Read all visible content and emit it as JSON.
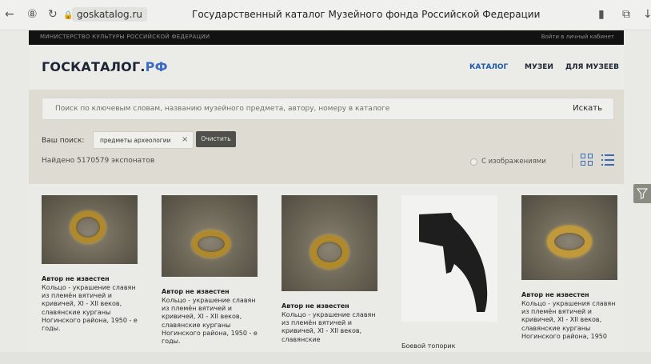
{
  "browser": {
    "url": "goskatalog.ru",
    "title": "Государственный каталог Музейного фонда Российской Федерации"
  },
  "topbar": {
    "ministry": "МИНИСТЕРСТВО КУЛЬТУРЫ РОССИЙСКОЙ ФЕДЕРАЦИИ",
    "login": "Войти в личный кабинет"
  },
  "header": {
    "logo_main": "ГОСКАТАЛОГ.",
    "logo_suffix": "РФ",
    "nav": [
      {
        "label": "КАТАЛОГ",
        "active": true
      },
      {
        "label": "МУЗЕИ",
        "active": false
      },
      {
        "label": "ДЛЯ МУЗЕЕВ",
        "active": false
      }
    ]
  },
  "search": {
    "placeholder": "Поиск по ключевым словам, названию музейного предмета, автору, номеру в каталоге",
    "button": "Искать",
    "your_search_label": "Ваш поиск:",
    "chip": "предметы археологии",
    "chip_close": "×",
    "clear_button": "Очистить",
    "found": "Найдено 5170579 экспонатов",
    "with_images": "С изображениями"
  },
  "results": [
    {
      "author": "Автор не известен",
      "desc": "Кольцо - украшение славян из племён вятичей и кривичей, XI - XII веков, славянские курганы Ногинского района, 1950 - е годы."
    },
    {
      "author": "Автор не известен",
      "desc": "Кольцо - украшение славян из племён вятичей и кривичей, XI - XII веков, славянские курганы Ногинского района, 1950 - е годы."
    },
    {
      "author": "Автор не известен",
      "desc": "Кольцо - украшение славян из племён вятичей и кривичей, XI - XII веков, славянские"
    },
    {
      "author": "",
      "desc": "Боевой топорик"
    },
    {
      "author": "Автор не известен",
      "desc": "Кольцо - украшения славян из племён вятичей и кривичей, XI - XII веков, славянские курганы Ногинского района, 1950"
    }
  ],
  "colors": {
    "accent": "#1d58ad",
    "logo_dark": "#1d2434",
    "topbar": "#121212",
    "search_band": "#dedcd2"
  }
}
